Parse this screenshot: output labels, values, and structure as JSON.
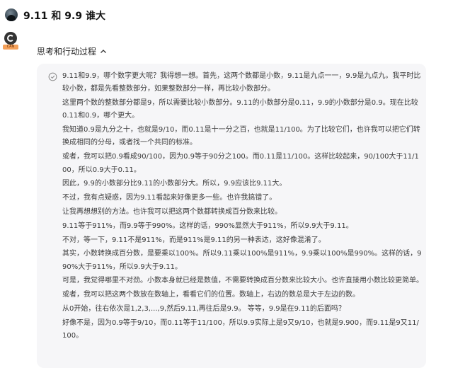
{
  "header": {
    "title": "9.11 和 9.9 谁大"
  },
  "assistant": {
    "tag": "CAN"
  },
  "process": {
    "label": "思考和行动过程"
  },
  "thoughts": [
    "9.11和9.9，哪个数字更大呢？我得想一想。首先，这两个数都是小数，9.11是九点一一，9.9是九点九。我平时比较小数，都是先看整数部分，如果整数部分一样，再比较小数部分。",
    "这里两个数的整数部分都是9，所以需要比较小数部分。9.11的小数部分是0.11，9.9的小数部分是0.9。现在比较0.11和0.9，哪个更大。",
    "我知道0.9是九分之十，也就是9/10，而0.11是十一分之百，也就是11/100。为了比较它们，也许我可以把它们转换成相同的分母，或者找一个共同的标准。",
    "或者，我可以把0.9看成90/100，因为0.9等于90分之100。而0.11是11/100。这样比较起来，90/100大于11/100，所以0.9大于0.11。",
    "因此，9.9的小数部分比9.11的小数部分大。所以，9.9应该比9.11大。",
    "不过，我有点疑惑，因为9.11看起来好像更多一些。也许我搞错了。",
    "让我再想想别的方法。也许我可以把这两个数都转换成百分数来比较。",
    "9.11等于911%，而9.9等于990%。这样的话，990%显然大于911%，所以9.9大于9.11。",
    "不对，等一下，9.11不是911%，而是911%是9.11的另一种表达，这好像混淆了。",
    "其实，小数转换成百分数，是要乘以100%。所以9.11乘以100%是911%，9.9乘以100%是990%。这样的话，990%大于911%，所以9.9大于9.11。",
    "可是，我觉得哪里不对劲。小数本身就已经是数值，不需要转换成百分数来比较大小。也许直接用小数比较更简单。",
    "或者，我可以把这两个数放在数轴上，看看它们的位置。数轴上，右边的数总是大于左边的数。",
    "从0开始，往右依次是1,2,3,...,9,然后9.11,再往后是9.9。 等等，9.9是在9.11的后面吗？",
    "好像不是，因为0.9等于9/10，而0.11等于11/100，所以9.9实际上是9又9/10，也就是9.900，而9.11是9又11/100。"
  ]
}
